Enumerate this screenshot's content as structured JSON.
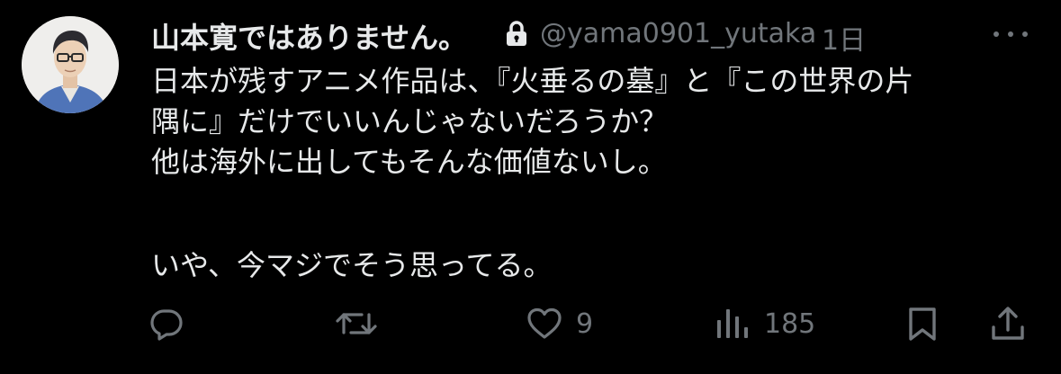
{
  "tweet": {
    "display_name": "山本寛ではありません。",
    "handle": "@yama0901_yutaka",
    "separator": "·",
    "time": "1日",
    "body_lines": [
      "日本が残すアニメ作品は、『火垂るの墓』と『この世界の片",
      "隅に』だけでいいんじゃないだろうか？",
      "他は海外に出してもそんな価値ないし。",
      "いや、今マジでそう思ってる。"
    ],
    "actions": {
      "reply_count": "",
      "retweet_count": "",
      "like_count": "9",
      "view_count": "185"
    },
    "icons": [
      "lock-icon",
      "more-icon",
      "reply-icon",
      "retweet-icon",
      "like-icon",
      "views-icon",
      "bookmark-icon",
      "share-icon"
    ]
  },
  "colors": {
    "background": "#000000",
    "primary_text": "#e7e9ea",
    "secondary_text": "#71767b"
  }
}
